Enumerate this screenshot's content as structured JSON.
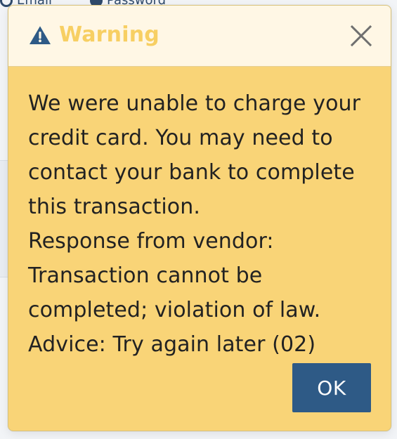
{
  "background": {
    "tabs": [
      {
        "label": "Email",
        "icon": "at-icon"
      },
      {
        "label": "Password",
        "icon": "info-icon"
      }
    ]
  },
  "modal": {
    "title": "Warning",
    "icon": "warning-triangle-icon",
    "close_icon": "close-icon",
    "message": "We were unable to charge your\ncredit card. You may need to\ncontact your bank to complete\nthis transaction.\nResponse from vendor:\nTransaction cannot be\ncompleted; violation of law.\nAdvice: Try again later (02)",
    "ok_label": "OK"
  },
  "colors": {
    "modal_bg": "#f9d477",
    "header_bg": "#fff7e5",
    "title_color": "#f7cf63",
    "icon_color": "#2e5a86",
    "close_icon_color": "#6f6f6f",
    "ok_bg": "#2e5a86",
    "ok_text": "#ffffff",
    "message_text": "#222222"
  }
}
